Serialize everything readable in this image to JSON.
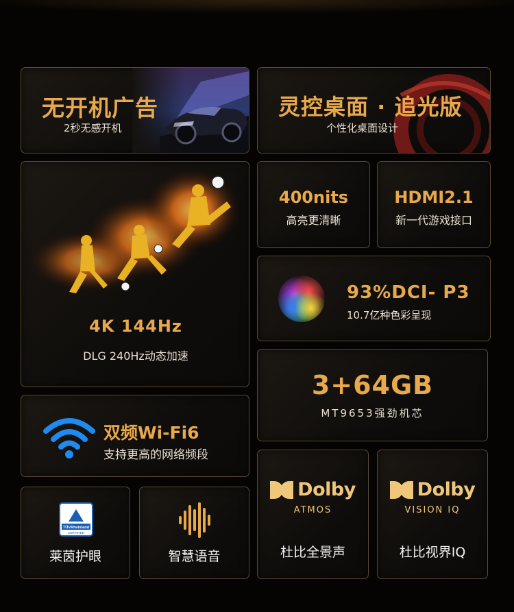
{
  "cards": {
    "ads": {
      "title": "无开机广告",
      "sub": "2秒无感开机"
    },
    "desk": {
      "title": "灵控桌面 · 追光版",
      "sub": "个性化桌面设计"
    },
    "res": {
      "title": "4K 144Hz",
      "sub": "DLG 240Hz动态加速"
    },
    "nits": {
      "title": "400nits",
      "sub": "高亮更清晰"
    },
    "hdmi": {
      "title": "HDMI2.1",
      "sub": "新一代游戏接口"
    },
    "dci": {
      "title": "93%DCI- P3",
      "sub": "10.7亿种色彩呈现"
    },
    "mem": {
      "title": "3+64GB",
      "sub": "MT9653强劲机芯"
    },
    "wifi": {
      "title": "双频Wi-Fi6",
      "sub": "支持更高的网络频段"
    },
    "eye": {
      "label": "莱茵护眼",
      "badge": "TÜVRheinland",
      "badge_sub": "CERTIFIED"
    },
    "voice": {
      "label": "智慧语音"
    },
    "atmos": {
      "brand": "Dolby",
      "sub": "ATMOS",
      "label": "杜比全景声"
    },
    "vision": {
      "brand": "Dolby",
      "sub": "VISION IQ",
      "label": "杜比视界IQ"
    }
  },
  "colors": {
    "gold": "#e8a94c",
    "cream": "#e9e0d2",
    "border": "#5a4a32",
    "wifi_blue": "#1f8bf0"
  },
  "icons": [
    "race-car-image",
    "red-ring-graphic",
    "soccer-players-image",
    "color-orb-icon",
    "wifi-icon",
    "tuv-badge-icon",
    "voice-wave-icon",
    "dolby-logo-icon"
  ]
}
